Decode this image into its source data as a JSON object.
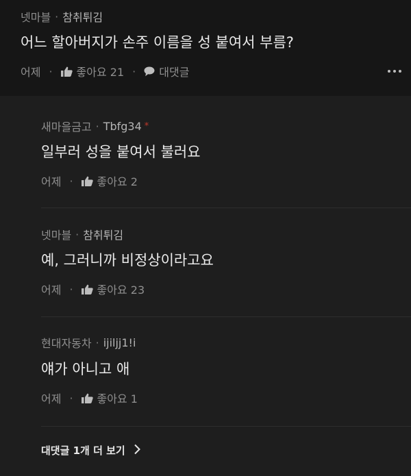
{
  "comment": {
    "group": "넷마블",
    "nickname": "참취튀김",
    "text": "어느 할아버지가 손주 이름을 성 붙여서 부름?",
    "time": "어제",
    "like_label": "좋아요 21",
    "reply_label": "대댓글"
  },
  "replies": [
    {
      "group": "새마을금고",
      "nickname": "Tbfg34",
      "badge": "*",
      "text": "일부러 성을 붙여서 불러요",
      "time": "어제",
      "like_label": "좋아요 2"
    },
    {
      "group": "넷마블",
      "nickname": "참취튀김",
      "text": "예, 그러니까 비정상이라고요",
      "time": "어제",
      "like_label": "좋아요 23"
    },
    {
      "group": "현대자동차",
      "nickname": "ijiljj1!i",
      "text": "얘가 아니고 애",
      "time": "어제",
      "like_label": "좋아요 1"
    }
  ],
  "view_more_label": "대댓글 1개 더 보기",
  "meta_separator": "·",
  "icons": {
    "like": "thumbs-up-icon",
    "reply": "speech-bubble-icon",
    "more": "more-horizontal-icon",
    "view_more": "chevron-right-icon"
  },
  "colors": {
    "background": "#161616",
    "reply_background": "#1e1e1e",
    "text": "#eaeaea",
    "muted": "#8f8f8f",
    "badge": "#c0392b"
  }
}
